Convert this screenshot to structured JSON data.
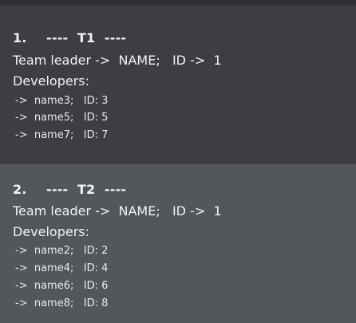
{
  "teams": [
    {
      "number": "1.",
      "title": "----  T1  ----",
      "leader_line": "Team leader ->  NAME;   ID ->  1",
      "developers_label": "Developers:",
      "developers": [
        "->  name3;   ID: 3",
        "->  name5;   ID: 5",
        "->  name7;   ID: 7"
      ]
    },
    {
      "number": "2.",
      "title": "----  T2  ----",
      "leader_line": "Team leader ->  NAME;   ID ->  1",
      "developers_label": "Developers:",
      "developers": [
        "->  name2;   ID: 2",
        "->  name4;   ID: 4",
        "->  name6;   ID: 6",
        "->  name8;   ID: 8"
      ]
    }
  ],
  "colors": {
    "team_1_background": "#3c3e42",
    "team_2_background": "#52575b",
    "page_background": "#2b2d30",
    "text": "#f2f3f4"
  }
}
